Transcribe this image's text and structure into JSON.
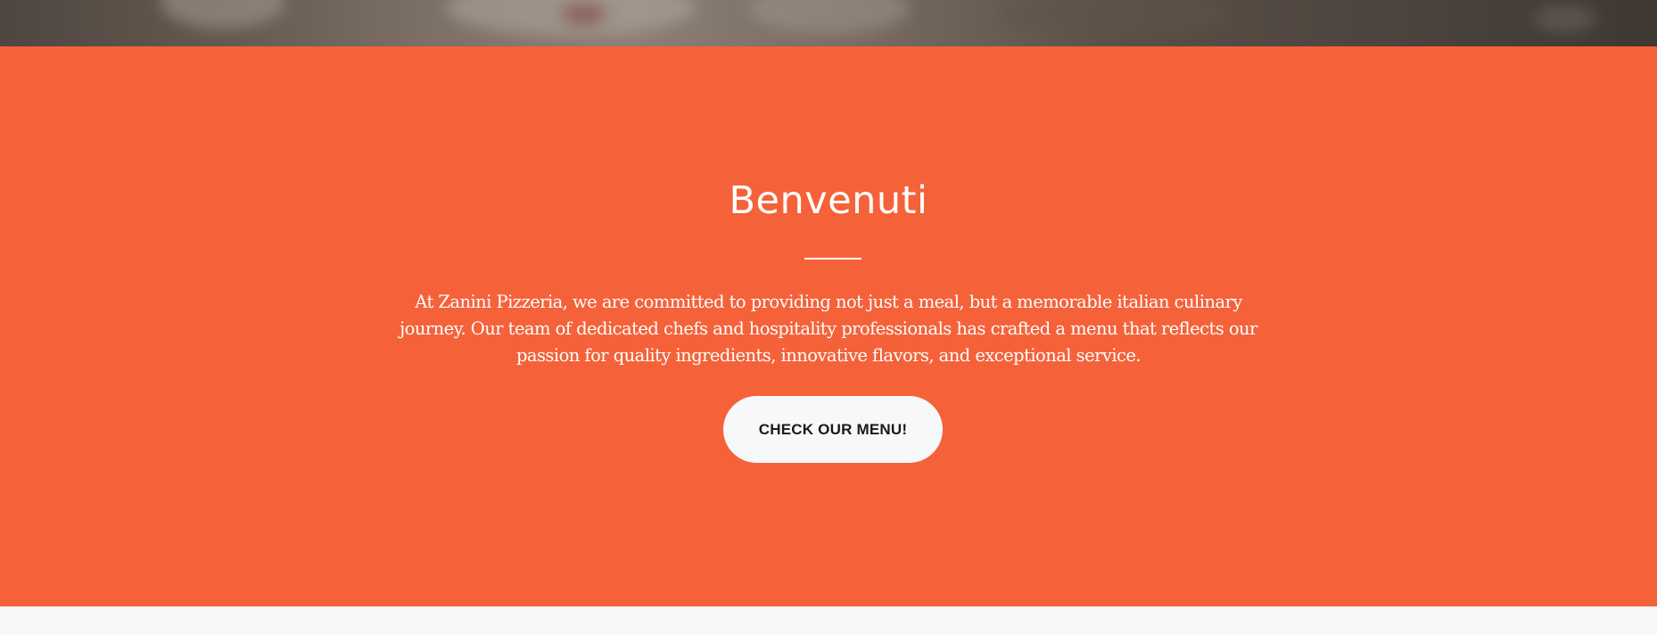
{
  "colors": {
    "section_background": "#f5623a",
    "button_background": "#f7f8fa",
    "text_on_orange": "#ffffff",
    "page_background": "#f7f8fa"
  },
  "welcome": {
    "title": "Benvenuti",
    "description": "At Zanini Pizzeria, we are committed to providing not just a meal, but a memorable italian culinary journey. Our team of dedicated chefs and hospitality professionals has crafted a menu that reflects our passion for quality ingredients, innovative flavors, and exceptional service.",
    "cta_label": "CHECK OUR MENU!"
  }
}
